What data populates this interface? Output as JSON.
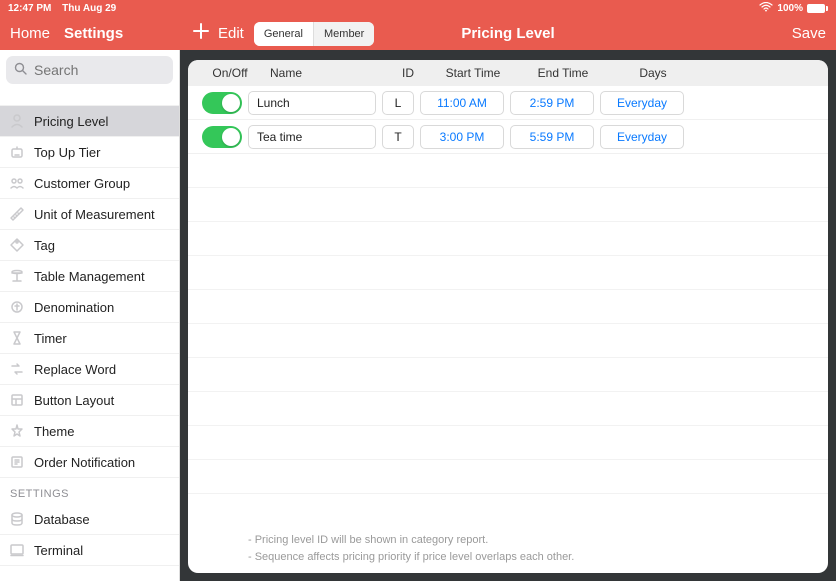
{
  "statusbar": {
    "time": "12:47 PM",
    "date": "Thu Aug 29",
    "battery_pct": "100%"
  },
  "topbar": {
    "home": "Home",
    "settings": "Settings",
    "edit": "Edit",
    "seg_general": "General",
    "seg_member": "Member",
    "title": "Pricing Level",
    "save": "Save"
  },
  "search": {
    "placeholder": "Search"
  },
  "sidebar": {
    "items": [
      {
        "label": "Pricing Level",
        "icon": "pricing",
        "selected": true
      },
      {
        "label": "Top Up Tier",
        "icon": "topup"
      },
      {
        "label": "Customer Group",
        "icon": "group"
      },
      {
        "label": "Unit of Measurement",
        "icon": "ruler"
      },
      {
        "label": "Tag",
        "icon": "tag"
      },
      {
        "label": "Table Management",
        "icon": "table"
      },
      {
        "label": "Denomination",
        "icon": "coin"
      },
      {
        "label": "Timer",
        "icon": "timer"
      },
      {
        "label": "Replace Word",
        "icon": "replace"
      },
      {
        "label": "Button Layout",
        "icon": "layout"
      },
      {
        "label": "Theme",
        "icon": "theme"
      },
      {
        "label": "Order Notification",
        "icon": "bell"
      }
    ],
    "section": "SETTINGS",
    "settings_items": [
      {
        "label": "Database",
        "icon": "database"
      },
      {
        "label": "Terminal",
        "icon": "terminal"
      }
    ]
  },
  "table": {
    "headers": {
      "onoff": "On/Off",
      "name": "Name",
      "id": "ID",
      "start": "Start Time",
      "end": "End Time",
      "days": "Days"
    },
    "rows": [
      {
        "on": true,
        "name": "Lunch",
        "id": "L",
        "start": "11:00 AM",
        "end": "2:59 PM",
        "days": "Everyday"
      },
      {
        "on": true,
        "name": "Tea time",
        "id": "T",
        "start": "3:00 PM",
        "end": "5:59 PM",
        "days": "Everyday"
      }
    ]
  },
  "footer": {
    "line1": "- Pricing level ID will be shown in category report.",
    "line2": "- Sequence affects pricing priority if price level overlaps each other."
  }
}
